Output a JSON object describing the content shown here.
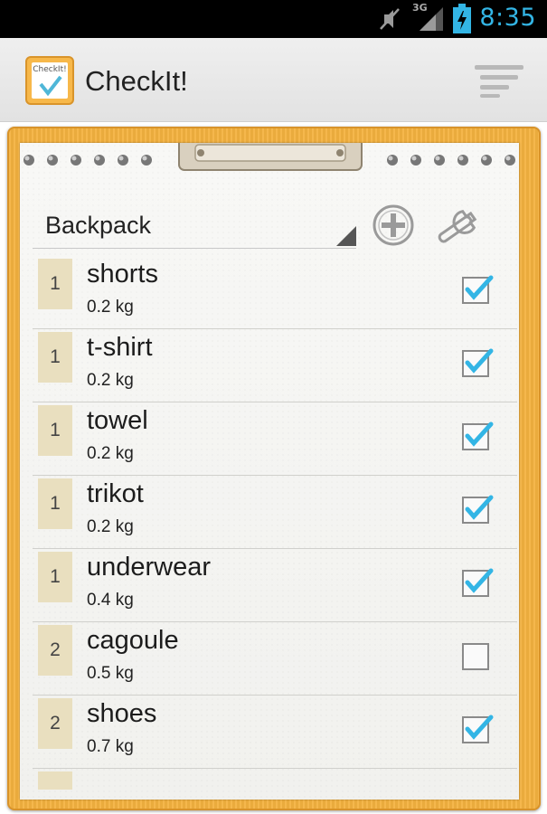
{
  "status_bar": {
    "time": "8:35",
    "network": "3G",
    "icons": [
      "mute-icon",
      "signal-icon",
      "battery-charging-icon"
    ],
    "accent": "#33b5e5"
  },
  "action_bar": {
    "app_title": "CheckIt!",
    "logo_text": "CheckIt!",
    "menu_icon": "menu-icon"
  },
  "list": {
    "selected": "Backpack",
    "add_icon": "add-circle-icon",
    "settings_icon": "wrench-icon"
  },
  "items": [
    {
      "qty": "1",
      "name": "shorts",
      "weight": "0.2 kg",
      "checked": true
    },
    {
      "qty": "1",
      "name": "t-shirt",
      "weight": "0.2 kg",
      "checked": true
    },
    {
      "qty": "1",
      "name": "towel",
      "weight": "0.2 kg",
      "checked": true
    },
    {
      "qty": "1",
      "name": "trikot",
      "weight": "0.2 kg",
      "checked": true
    },
    {
      "qty": "1",
      "name": "underwear",
      "weight": "0.4 kg",
      "checked": true
    },
    {
      "qty": "2",
      "name": "cagoule",
      "weight": "0.5 kg",
      "checked": false
    },
    {
      "qty": "2",
      "name": "shoes",
      "weight": "0.7 kg",
      "checked": true
    }
  ],
  "colors": {
    "clipboard": "#f4b23f",
    "qty_badge": "#e9dfbf",
    "checkmark": "#33b5e5"
  }
}
